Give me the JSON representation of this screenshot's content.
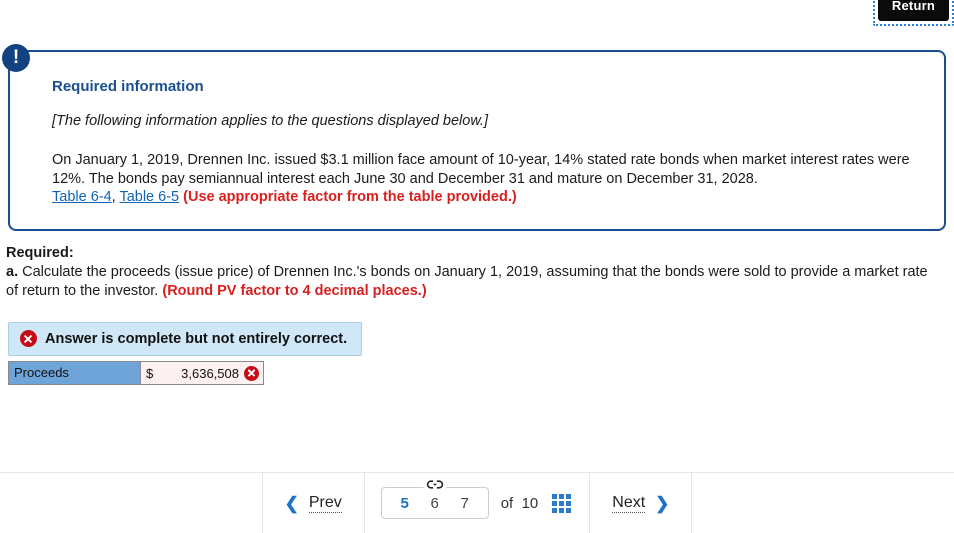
{
  "toolbar": {
    "return_label": "Return"
  },
  "info_box": {
    "badge_icon": "exclamation-icon",
    "title": "Required information",
    "italic_note": "[The following information applies to the questions displayed below.]",
    "body_part1": "On January 1, 2019, Drennen Inc. issued $3.1 million face amount of 10-year, 14% stated rate bonds when market interest rates were 12%. The bonds pay semiannual interest each June 30 and December 31 and mature on December 31, 2028.",
    "link1": "Table 6-4",
    "link_separator": ", ",
    "link2": "Table 6-5",
    "body_note": "(Use appropriate factor from the table provided.)"
  },
  "required": {
    "label": "Required:",
    "item_marker": "a.",
    "text": " Calculate the proceeds (issue price) of Drennen Inc.'s bonds on January 1, 2019, assuming that the bonds were sold to provide a market rate of return to the investor. ",
    "note": "(Round PV factor to 4 decimal places.)"
  },
  "status": {
    "icon": "x-circle-icon",
    "message": "Answer is complete but not entirely correct."
  },
  "answer": {
    "row_label": "Proceeds",
    "currency": "$",
    "value": "3,636,508",
    "mark_icon": "x-circle-icon"
  },
  "pagination": {
    "prev_label": "Prev",
    "prev_icon": "chevron-left-icon",
    "next_label": "Next",
    "next_icon": "chevron-right-icon",
    "link_icon": "link-chain-icon",
    "pages": [
      "5",
      "6",
      "7"
    ],
    "active_page": "5",
    "of_label": "of",
    "total_pages": "10",
    "grid_icon": "grid-view-icon"
  },
  "colors": {
    "brand_navy": "#1b4f91",
    "link_blue": "#1163b4",
    "alert_red": "#d91f1f",
    "banner_blue": "#cfe7f7",
    "row_blue": "#6fa4d8",
    "error_cell": "#fdf0f1",
    "accent_blue": "#2a7ad1"
  }
}
